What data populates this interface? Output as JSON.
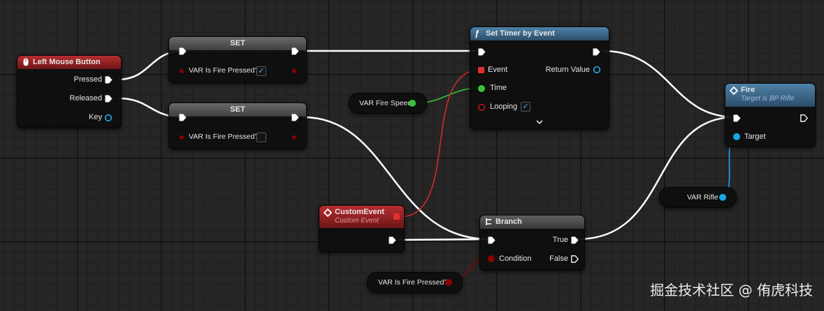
{
  "colors": {
    "exec": "#ffffff",
    "bool_pin": "#8b0000",
    "float_pin": "#39c339",
    "object_pin": "#1aa7e8",
    "delegate_pin": "#e02f2f",
    "event_header": "#b72e30",
    "function_header": "#4f82a8"
  },
  "nodes": {
    "left_mouse_button": {
      "title": "Left Mouse Button",
      "pins": {
        "pressed": "Pressed",
        "released": "Released",
        "key": "Key"
      }
    },
    "set_top": {
      "title": "SET",
      "var_label": "VAR Is Fire Pressed?",
      "checked": true
    },
    "set_bottom": {
      "title": "SET",
      "var_label": "VAR Is Fire Pressed?",
      "checked": false
    },
    "var_fire_speed": {
      "label": "VAR Fire Speed"
    },
    "set_timer": {
      "title": "Set Timer by Event",
      "pins": {
        "event": "Event",
        "time": "Time",
        "looping": "Looping",
        "return_value": "Return Value"
      },
      "looping_checked": true
    },
    "fire": {
      "title": "Fire",
      "subtitle": "Target is BP Rifle",
      "target": "Target"
    },
    "var_rifle": {
      "label": "VAR Rifle"
    },
    "custom_event": {
      "title": "CustomEvent",
      "subtitle": "Custom Event"
    },
    "branch": {
      "title": "Branch",
      "pins": {
        "condition": "Condition",
        "true": "True",
        "false": "False"
      }
    },
    "var_is_fire_pressed": {
      "label": "VAR Is Fire Pressed?"
    }
  },
  "watermark": "掘金技术社区 @ 侑虎科技"
}
